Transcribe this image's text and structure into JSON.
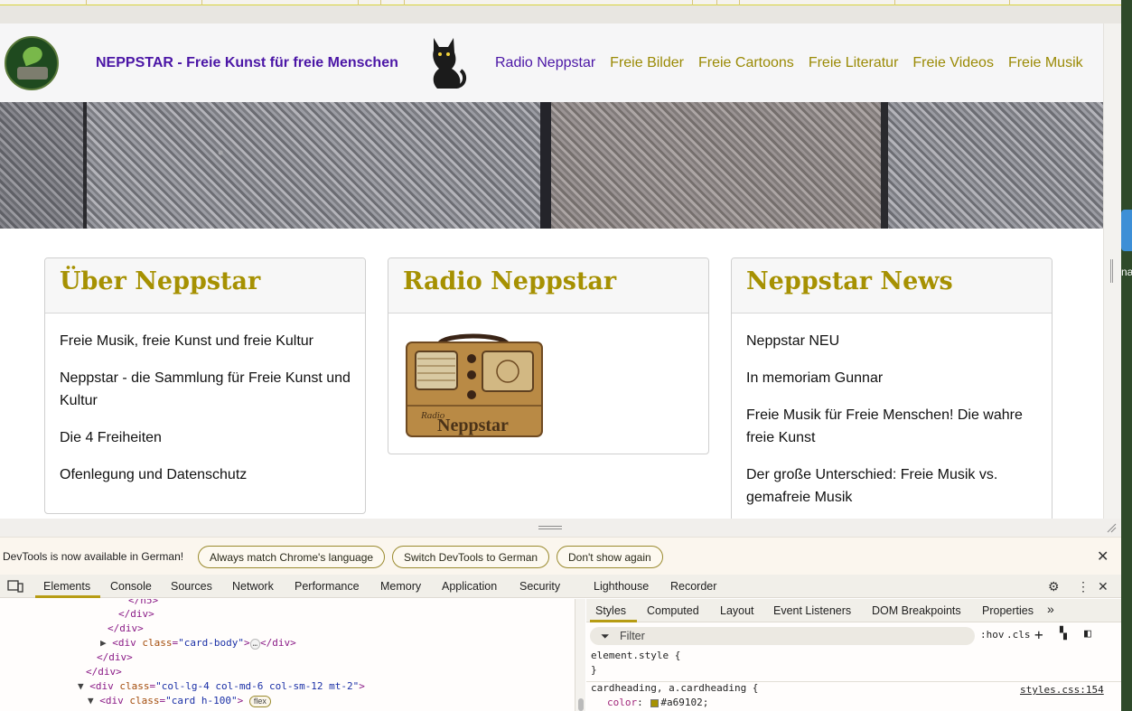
{
  "site": {
    "brand": "NEPPSTAR - Freie Kunst für freie Menschen",
    "nav": [
      "Radio Neppstar",
      "Freie Bilder",
      "Freie Cartoons",
      "Freie Literatur",
      "Freie Videos",
      "Freie Musik"
    ],
    "cards": [
      {
        "title": "Über Neppstar",
        "items": [
          "Freie Musik, freie Kunst und freie Kultur",
          "Neppstar - die Sammlung für Freie Kunst und Kultur",
          "Die 4 Freiheiten",
          "Ofenlegung und Datenschutz"
        ]
      },
      {
        "title": "Radio Neppstar",
        "image_caption_small": "Radio",
        "image_caption_large": "Neppstar"
      },
      {
        "title": "Neppstar News",
        "items": [
          "Neppstar NEU",
          "In memoriam Gunnar",
          "Freie Musik für Freie Menschen! Die wahre freie Kunst",
          "Der große Unterschied: Freie Musik vs. gemafreie Musik"
        ]
      }
    ]
  },
  "os": {
    "edge_text": "na"
  },
  "devtools": {
    "infobar": {
      "message": "DevTools is now available in German!",
      "buttons": [
        "Always match Chrome's language",
        "Switch DevTools to German",
        "Don't show again"
      ]
    },
    "tabs": [
      "Elements",
      "Console",
      "Sources",
      "Network",
      "Performance",
      "Memory",
      "Application",
      "Security",
      "Lighthouse",
      "Recorder"
    ],
    "active_tab": "Elements",
    "elements_lines": [
      {
        "text": "</h5>"
      },
      {
        "text": "</div>"
      },
      {
        "text": "</div>"
      },
      {
        "open": "<div ",
        "attr": "class",
        "val": "\"card-body\"",
        "close": ">",
        "ellipsis": "…",
        "end": "</div>"
      },
      {
        "text": "</div>"
      },
      {
        "text": "</div>"
      },
      {
        "open": "<div ",
        "attr": "class",
        "val": "\"col-lg-4 col-md-6 col-sm-12 mt-2\"",
        "close": ">"
      },
      {
        "open": "<div ",
        "attr": "class",
        "val": "\"card h-100\"",
        "close": ">",
        "badge": "flex"
      }
    ],
    "styles_tabs": [
      "Styles",
      "Computed",
      "Layout",
      "Event Listeners",
      "DOM Breakpoints",
      "Properties"
    ],
    "filter_placeholder": "Filter",
    "tools": [
      ":hov",
      ".cls"
    ],
    "rules": {
      "element_style_open": "element.style {",
      "element_style_close": "}",
      "selector": "cardheading, a.cardheading {",
      "property": "color",
      "value": "#a69102;",
      "source": "styles.css:154"
    }
  },
  "colors": {
    "accent": "#a69102",
    "brand": "#4b16a6"
  }
}
